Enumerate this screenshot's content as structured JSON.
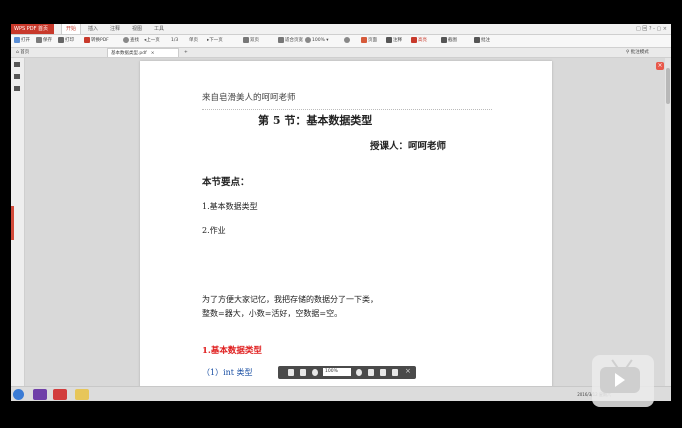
{
  "app": {
    "name": "WPS PDF 首页",
    "menu_tabs": [
      "开始",
      "插入",
      "注释",
      "视图",
      "工具"
    ],
    "window_controls": "□ 回 ? - ▢ ×"
  },
  "toolbar": {
    "items": [
      "打开",
      "保存",
      "打印",
      "转换PDF",
      "查找",
      "上一页",
      "下一页",
      "1/3",
      "单页",
      "双页",
      "适合页宽",
      "100%",
      "页面",
      "注释",
      "高亮",
      "截图",
      "批注"
    ],
    "zoom": "100%"
  },
  "tabbar": {
    "home_tab": "首页",
    "doc_tab": "基本数据类型.pdf",
    "right_text": "批注模式"
  },
  "document": {
    "header_note": "来自皂滑美人的呵呵老师",
    "title": "第 5 节：基本数据类型",
    "author": "授课人：呵呵老师",
    "key_points_heading": "本节要点：",
    "point1": "1.基本数据类型",
    "point2": "2.作业",
    "para_line1": "为了方便大家记忆，我把存储的数据分了一下类，",
    "para_line2": "整数=器大，小数=活好，空数据=空。",
    "section_heading": "1.基本数据类型",
    "subitem": "（1）int 类型"
  },
  "float_toolbar": {
    "zoom": "100%"
  },
  "taskbar": {
    "tray_text": "2016/3/12 星期六"
  },
  "colors": {
    "brand_red": "#c8392b",
    "section_red": "#e02020",
    "page_bg": "#ffffff",
    "workspace_bg": "#d9d9d9"
  }
}
